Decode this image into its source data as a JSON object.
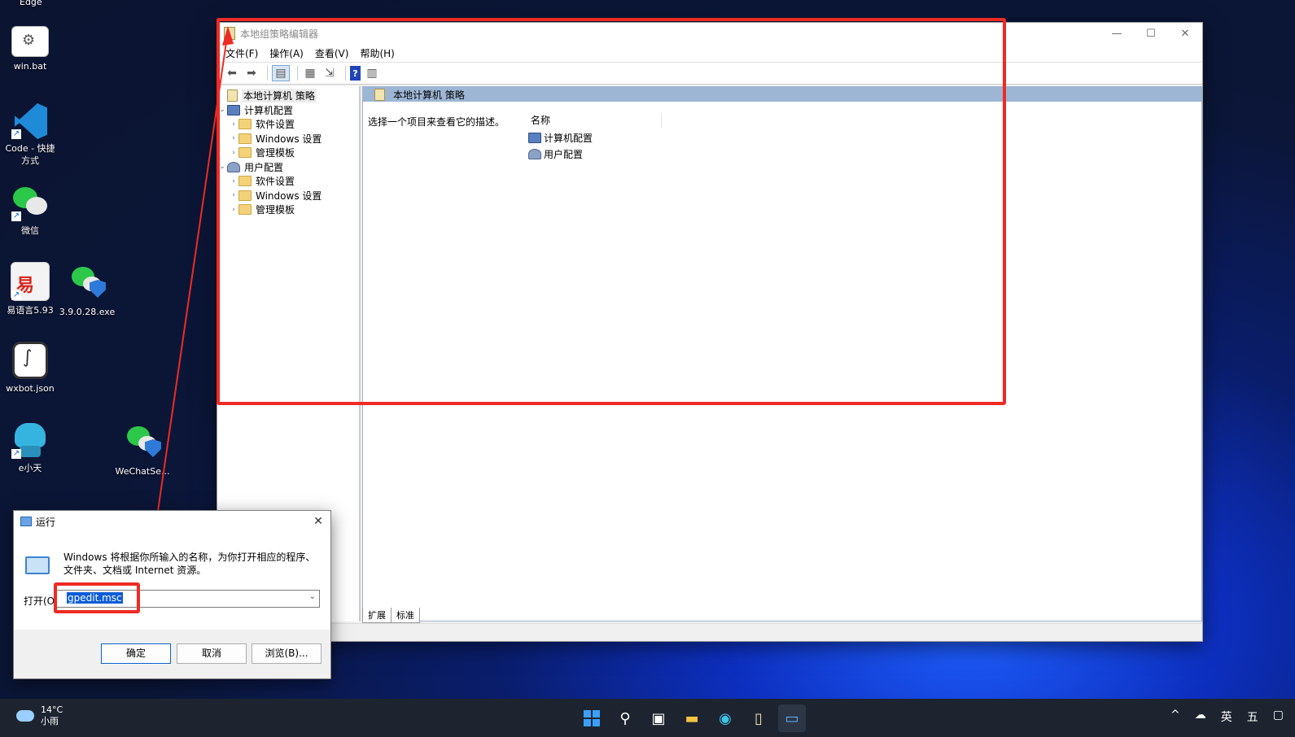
{
  "desktop": {
    "top_partial_label": "Edge",
    "icons": [
      {
        "label": "win.bat"
      },
      {
        "label": "Code - 快捷方式"
      },
      {
        "label": "微信"
      },
      {
        "label": "易语言5.93"
      },
      {
        "label": "3.9.0.28.exe"
      },
      {
        "label": "wxbot.json"
      },
      {
        "label": "e小天"
      },
      {
        "label": "WeChatSe..."
      }
    ]
  },
  "window": {
    "title": "本地组策略编辑器",
    "controls": {
      "minimize": "—",
      "maximize": "☐",
      "close": "✕"
    },
    "menu": [
      "文件(F)",
      "操作(A)",
      "查看(V)",
      "帮助(H)"
    ],
    "tree": {
      "root": "本地计算机 策略",
      "computer": {
        "label": "计算机配置",
        "children": [
          "软件设置",
          "Windows 设置",
          "管理模板"
        ]
      },
      "user": {
        "label": "用户配置",
        "children": [
          "软件设置",
          "Windows 设置",
          "管理模板"
        ]
      }
    },
    "right_header": "本地计算机 策略",
    "description": "选择一个项目来查看它的描述。",
    "list_header": "名称",
    "list_items": [
      "计算机配置",
      "用户配置"
    ],
    "tabs": [
      "扩展",
      "标准"
    ]
  },
  "run_dialog": {
    "title": "运行",
    "close": "✕",
    "text": "Windows 将根据你所输入的名称，为你打开相应的程序、文件夹、文档或 Internet 资源。",
    "open_label": "打开(O):",
    "open_value": "gpedit.msc",
    "buttons": {
      "ok": "确定",
      "cancel": "取消",
      "browse": "浏览(B)..."
    }
  },
  "taskbar": {
    "weather": {
      "temp": "14°C",
      "condition": "小雨"
    },
    "tray": {
      "chevron": "^",
      "ime": "英",
      "day": "五"
    }
  },
  "colors": {
    "annotation_red": "#ee2b24",
    "selection_blue": "#0b5cd6"
  }
}
